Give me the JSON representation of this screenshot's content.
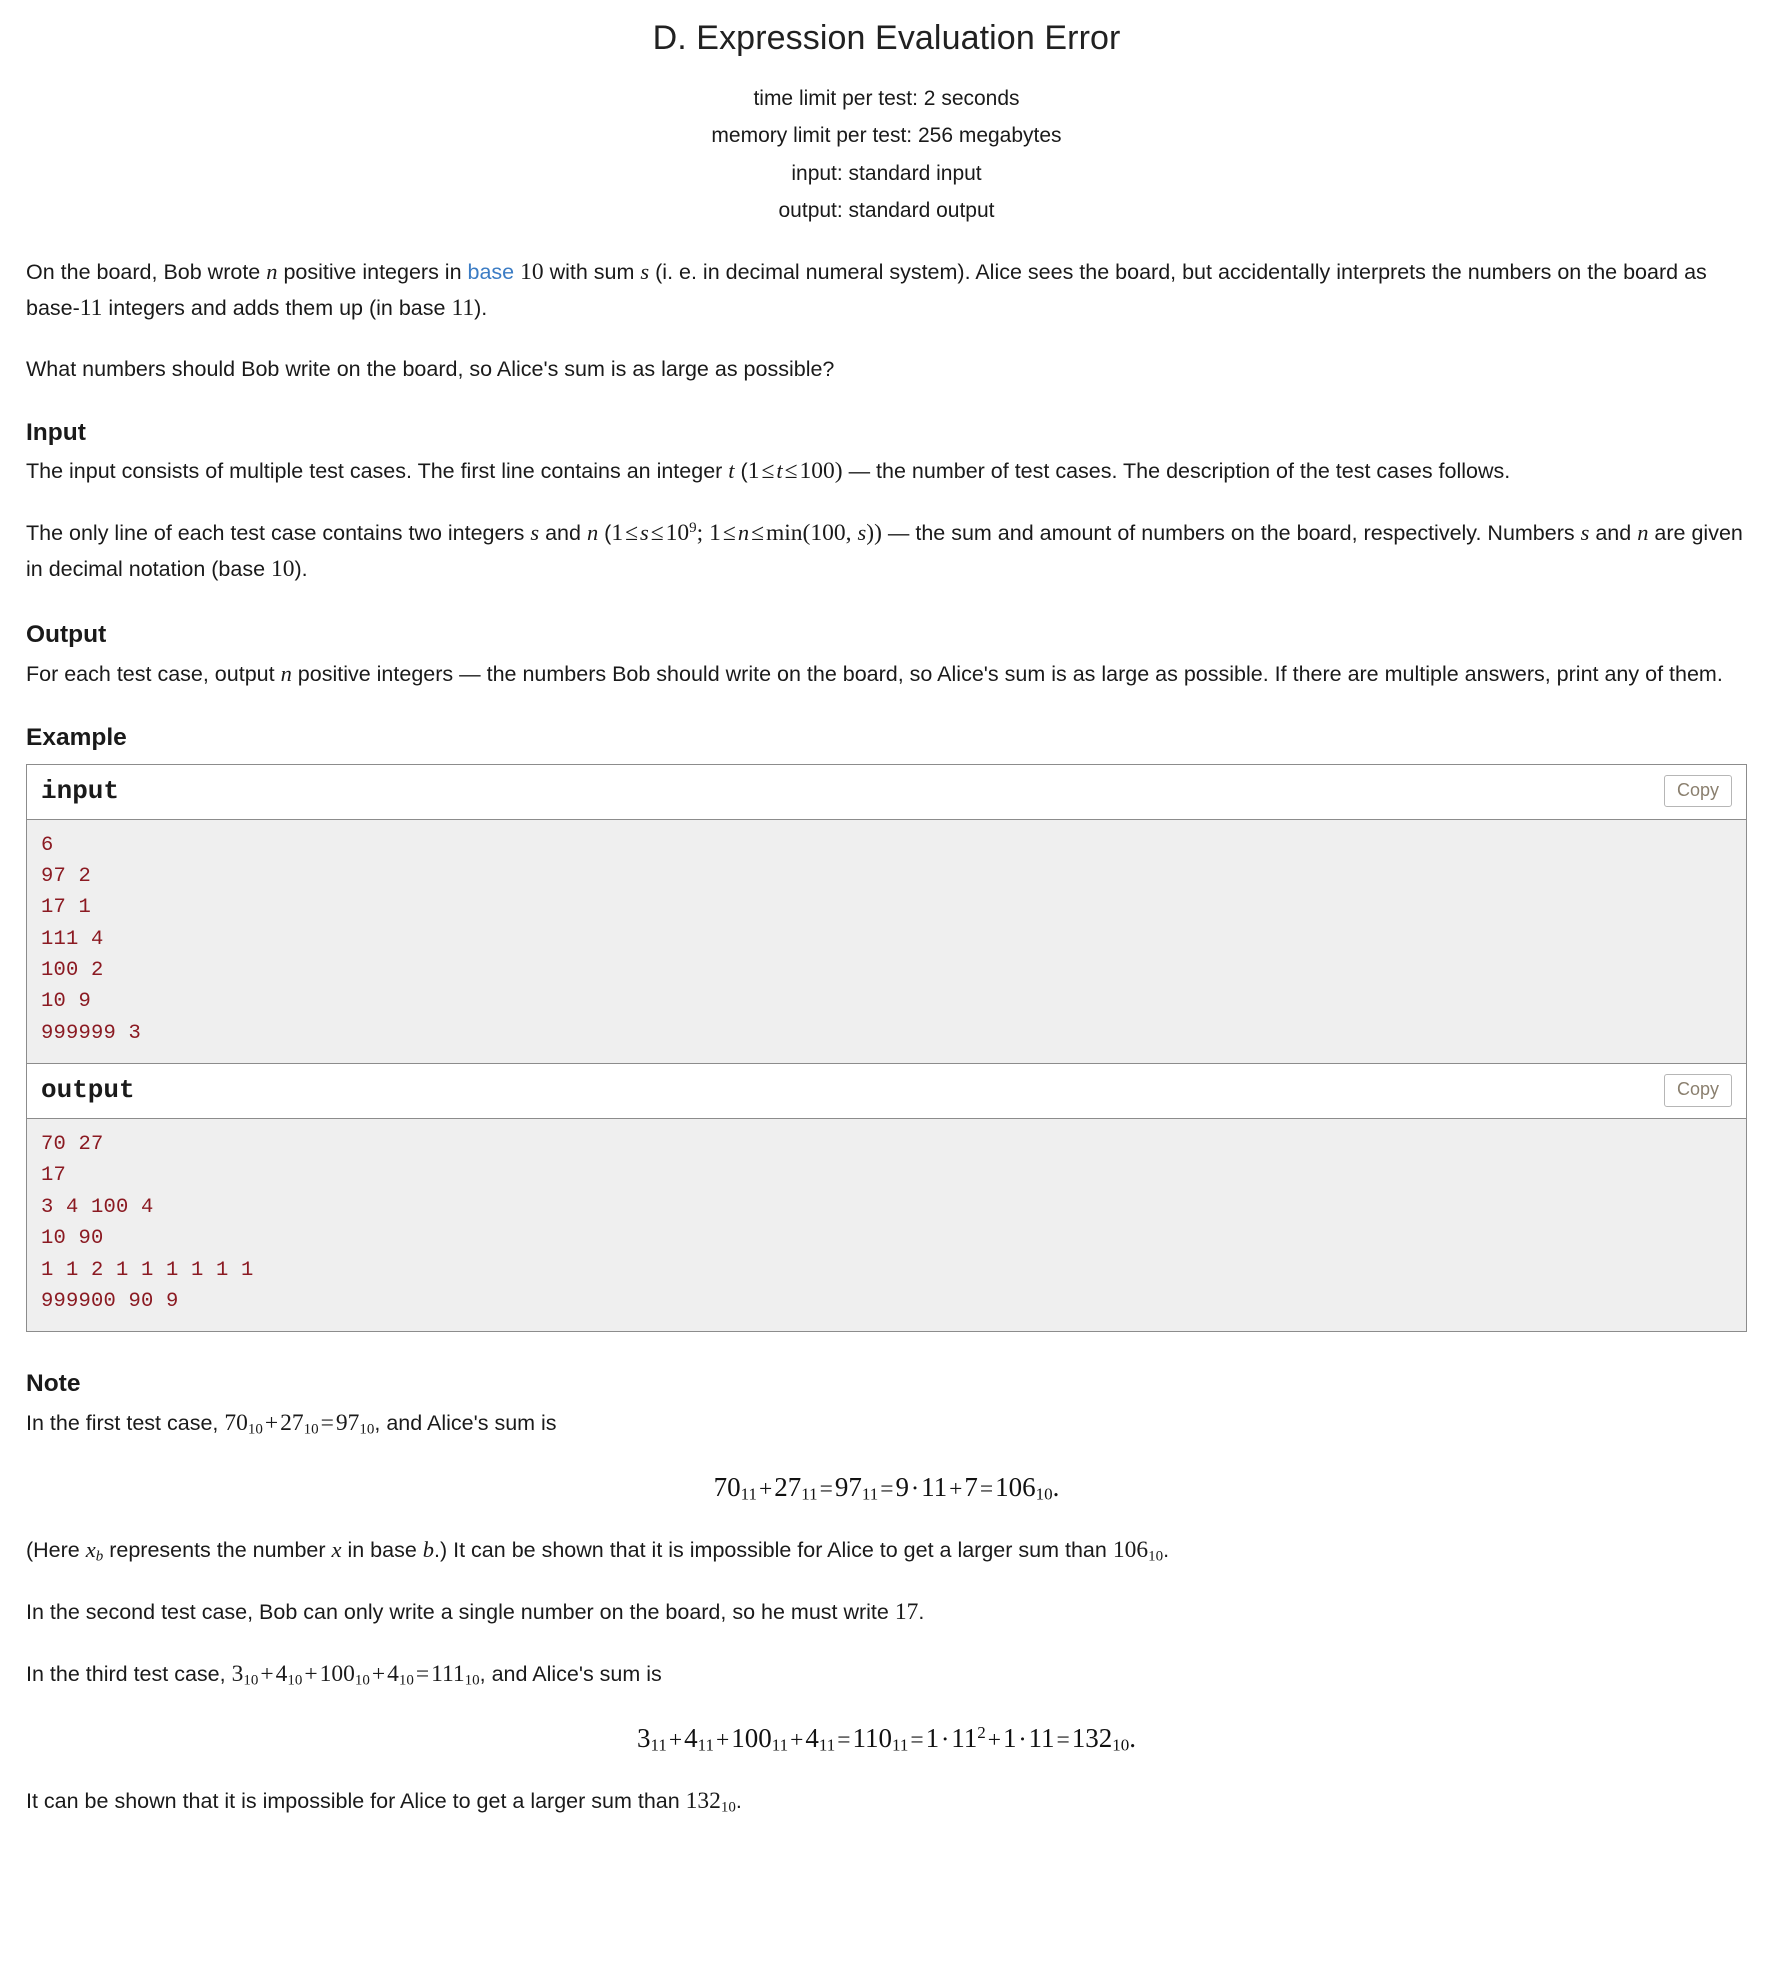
{
  "header": {
    "title": "D. Expression Evaluation Error",
    "time_limit": "time limit per test: 2 seconds",
    "memory_limit": "memory limit per test: 256 megabytes",
    "input_spec": "input: standard input",
    "output_spec": "output: standard output"
  },
  "statement": {
    "p1_a": "On the board, Bob wrote ",
    "p1_n": "n",
    "p1_b": " positive integers in ",
    "p1_base_link": "base",
    "p1_ten": "10",
    "p1_c": " with sum ",
    "p1_s": "s",
    "p1_d": " (i. e. in decimal numeral system). Alice sees the board, but accidentally interprets the numbers on the board as base-",
    "p1_eleven": "11",
    "p1_e": " integers and adds them up (in base ",
    "p1_eleven2": "11",
    "p1_f": ").",
    "p2": "What numbers should Bob write on the board, so Alice's sum is as large as possible?"
  },
  "input_section": {
    "heading": "Input",
    "p1_a": "The input consists of multiple test cases. The first line contains an integer ",
    "p1_t": "t",
    "p1_open": " (",
    "p1_one": "1",
    "p1_le1": "≤",
    "p1_t2": "t",
    "p1_le2": "≤",
    "p1_hundred": "100",
    "p1_close": ")",
    "p1_b": " — the number of test cases. The description of the test cases follows.",
    "p2_a": "The only line of each test case contains two integers ",
    "p2_s": "s",
    "p2_and": " and ",
    "p2_n": "n",
    "p2_open": " (",
    "p2_one": "1",
    "p2_le1": "≤",
    "p2_s2": "s",
    "p2_le2": "≤",
    "p2_pow_base": "10",
    "p2_pow_exp": "9",
    "p2_semi": ";",
    "p2_one2": "1",
    "p2_le3": "≤",
    "p2_n2": "n",
    "p2_le4": "≤",
    "p2_min": "min",
    "p2_minopen": "(",
    "p2_min100": "100",
    "p2_comma": ",",
    "p2_mins": "s",
    "p2_minclose": ")",
    "p2_close": ")",
    "p2_b": " — the sum and amount of numbers on the board, respectively. Numbers ",
    "p2_s3": "s",
    "p2_and2": " and ",
    "p2_n3": "n",
    "p2_c": " are given in decimal notation (base ",
    "p2_ten": "10",
    "p2_d": ")."
  },
  "output_section": {
    "heading": "Output",
    "p1_a": "For each test case, output ",
    "p1_n": "n",
    "p1_b": " positive integers — the numbers Bob should write on the board, so Alice's sum is as large as possible. If there are multiple answers, print any of them."
  },
  "example": {
    "heading": "Example",
    "copy_label": "Copy",
    "input_title": "input",
    "output_title": "output",
    "input_text": "6\n97 2\n17 1\n111 4\n100 2\n10 9\n999999 3",
    "output_text": "70 27\n17\n3 4 100 4\n10 90\n1 1 2 1 1 1 1 1 1\n999900 90 9"
  },
  "note_section": {
    "heading": "Note",
    "n1_a": "In the first test case, ",
    "n1_70": "70",
    "n1_70s": "10",
    "n1_plus": "+",
    "n1_27": "27",
    "n1_27s": "10",
    "n1_eq": "=",
    "n1_97": "97",
    "n1_97s": "10",
    "n1_b": ", and Alice's sum is",
    "eq1": {
      "a70": "70",
      "a70s": "11",
      "plus1": "+",
      "a27": "27",
      "a27s": "11",
      "eq1": "=",
      "a97": "97",
      "a97s": "11",
      "eq2": "=",
      "a9": "9",
      "cdot": "⋅",
      "a11": "11",
      "plus2": "+",
      "a7": "7",
      "eq3": "=",
      "a106": "106",
      "a106s": "10",
      "period": "."
    },
    "n2_a": "(Here ",
    "n2_x": "x",
    "n2_xs": "b",
    "n2_b": " represents the number ",
    "n2_x2": "x",
    "n2_c": " in base ",
    "n2_bb": "b",
    "n2_d": ".) It can be shown that it is impossible for Alice to get a larger sum than ",
    "n2_106": "106",
    "n2_106s": "10",
    "n2_e": ".",
    "n3_a": "In the second test case, Bob can only write a single number on the board, so he must write ",
    "n3_17": "17",
    "n3_b": ".",
    "n4_a": "In the third test case, ",
    "n4_3": "3",
    "n4_3s": "10",
    "n4_p1": "+",
    "n4_4": "4",
    "n4_4s": "10",
    "n4_p2": "+",
    "n4_100": "100",
    "n4_100s": "10",
    "n4_p3": "+",
    "n4_4b": "4",
    "n4_4bs": "10",
    "n4_eq": "=",
    "n4_111": "111",
    "n4_111s": "10",
    "n4_b": ", and Alice's sum is",
    "eq2": {
      "a3": "3",
      "a3s": "11",
      "plus1": "+",
      "a4": "4",
      "a4s": "11",
      "plus2": "+",
      "a100": "100",
      "a100s": "11",
      "plus3": "+",
      "a4b": "4",
      "a4bs": "11",
      "eq1": "=",
      "a110": "110",
      "a110s": "11",
      "eq2": "=",
      "one": "1",
      "cdot1": "⋅",
      "b11": "11",
      "exp": "2",
      "plus4": "+",
      "one2": "1",
      "cdot2": "⋅",
      "b11b": "11",
      "eq3": "=",
      "a132": "132",
      "a132s": "10",
      "period": "."
    },
    "n5_a": "It can be shown that it is impossible for Alice to get a larger sum than ",
    "n5_132": "132",
    "n5_132s": "10",
    "n5_b": "."
  },
  "colors": {
    "link": "#3b7cc4",
    "sample_text": "#8b1a22",
    "sample_bg": "#efefef",
    "border": "#8c8c8c",
    "copy_text": "#8a7f6e"
  }
}
